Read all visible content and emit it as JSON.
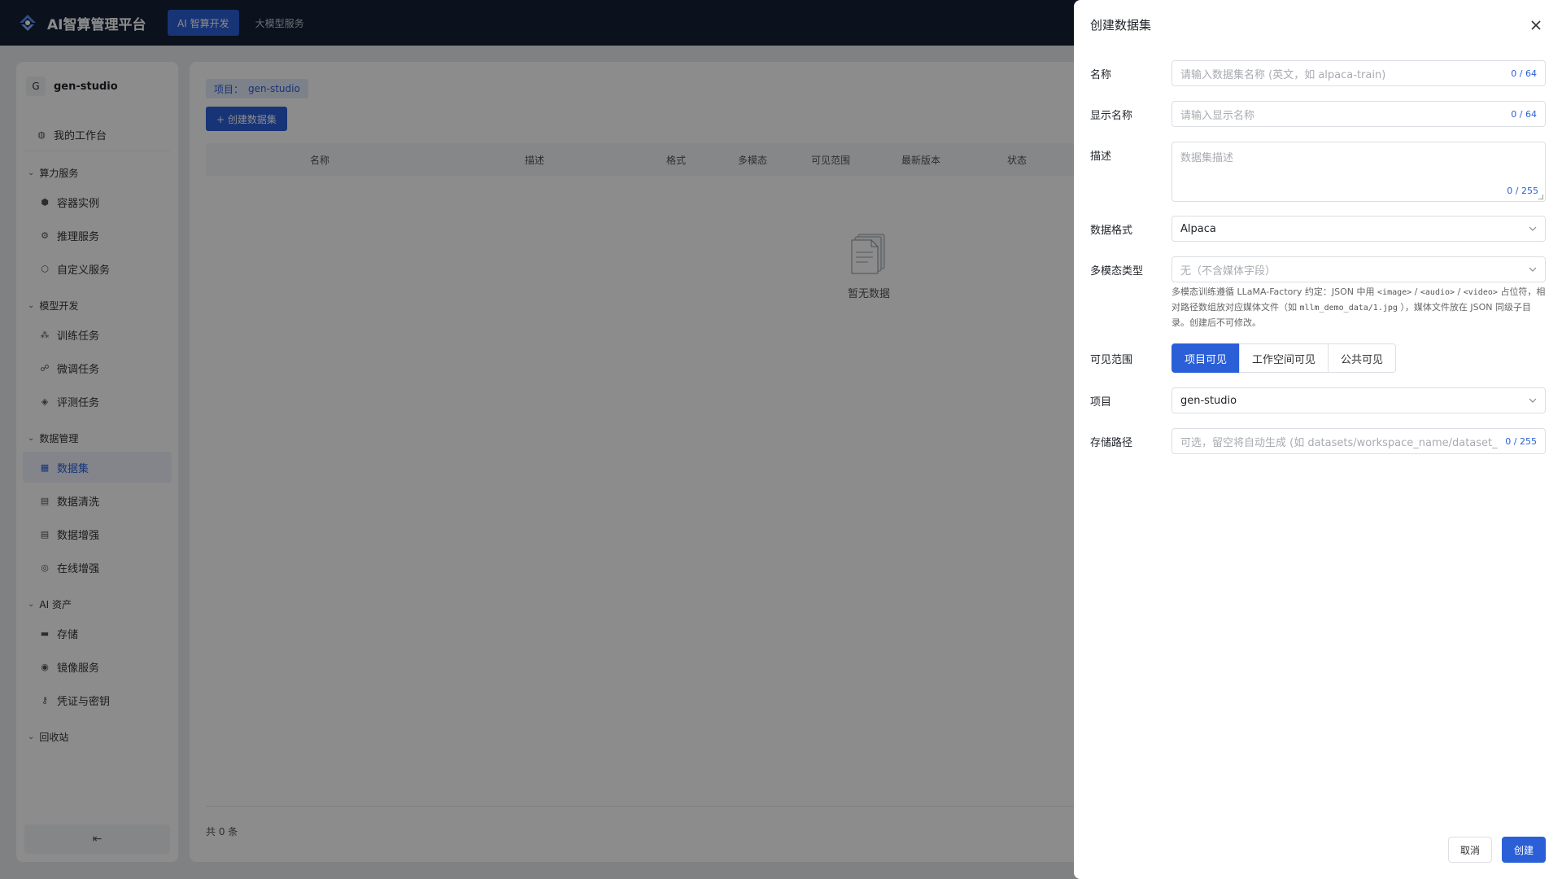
{
  "app": {
    "title": "AI智算管理平台"
  },
  "topnav": [
    {
      "label": "AI 智算开发",
      "active": true
    },
    {
      "label": "大模型服务",
      "active": false
    }
  ],
  "sidebar": {
    "project_avatar": "G",
    "project_name": "gen-studio",
    "home": "我的工作台",
    "groups": [
      {
        "title": "算力服务",
        "items": [
          "容器实例",
          "推理服务",
          "自定义服务"
        ]
      },
      {
        "title": "模型开发",
        "items": [
          "训练任务",
          "微调任务",
          "评测任务"
        ]
      },
      {
        "title": "数据管理",
        "items": [
          "数据集",
          "数据清洗",
          "数据增强",
          "在线增强"
        ]
      },
      {
        "title": "AI 资产",
        "items": [
          "存储",
          "镜像服务",
          "凭证与密钥"
        ]
      },
      {
        "title": "回收站",
        "items": []
      }
    ],
    "collapse_icon": "collapse-left-icon"
  },
  "main": {
    "project_badge_label": "项目：",
    "project_badge_value": "gen-studio",
    "create_button": "+ 创建数据集",
    "table_headers": [
      "名称",
      "描述",
      "格式",
      "多模态",
      "可见范围",
      "最新版本",
      "状态"
    ],
    "empty_text": "暂无数据",
    "total_text": "共 0 条"
  },
  "drawer": {
    "title": "创建数据集",
    "fields": {
      "name": {
        "label": "名称",
        "placeholder": "请输入数据集名称 (英文，如 alpaca-train)",
        "counter": "0 / 64"
      },
      "display_name": {
        "label": "显示名称",
        "placeholder": "请输入显示名称",
        "counter": "0 / 64"
      },
      "description": {
        "label": "描述",
        "placeholder": "数据集描述",
        "counter": "0 / 255"
      },
      "format": {
        "label": "数据格式",
        "value": "Alpaca"
      },
      "multimodal": {
        "label": "多模态类型",
        "value": "无（不含媒体字段）",
        "hint_part1": "多模态训练遵循 LLaMA-Factory 约定：JSON 中用",
        "hint_code1": "<image>",
        "hint_sep1": " / ",
        "hint_code2": "<audio>",
        "hint_sep2": " / ",
        "hint_code3": "<video>",
        "hint_part2": " 占位符，相对路径数组放对应媒体文件（如",
        "hint_code4": "mllm_demo_data/1.jpg",
        "hint_part3": "），媒体文件放在 JSON 同级子目录。创建后不可修改。"
      },
      "visibility": {
        "label": "可见范围",
        "options": [
          "项目可见",
          "工作空间可见",
          "公共可见"
        ],
        "selected": 0
      },
      "project": {
        "label": "项目",
        "value": "gen-studio"
      },
      "storage_path": {
        "label": "存储路径",
        "placeholder": "可选，留空将自动生成 (如 datasets/workspace_name/dataset_",
        "counter": "0 / 255"
      }
    },
    "cancel": "取消",
    "submit": "创建"
  },
  "colors": {
    "primary": "#2a5fd8",
    "topbar": "#142035"
  }
}
